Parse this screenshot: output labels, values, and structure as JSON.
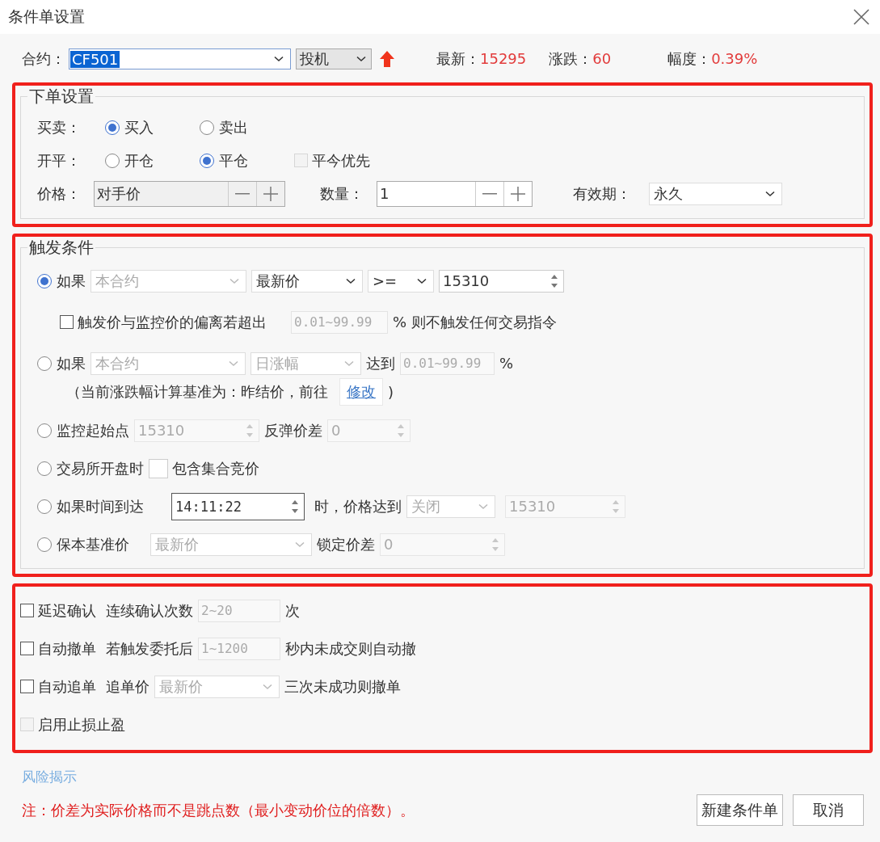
{
  "window": {
    "title": "条件单设置"
  },
  "contract": {
    "label": "合约：",
    "value": "CF501",
    "hedge": "投机",
    "quotes": [
      {
        "label": "最新：",
        "value": "15295"
      },
      {
        "label": "涨跌：",
        "value": "60"
      },
      {
        "label": "幅度：",
        "value": "0.39%"
      }
    ]
  },
  "order_settings": {
    "title": "下单设置",
    "side": {
      "label": "买卖：",
      "options": [
        {
          "label": "买入",
          "selected": true
        },
        {
          "label": "卖出",
          "selected": false
        }
      ]
    },
    "open_close": {
      "label": "开平：",
      "options": [
        {
          "label": "开仓",
          "selected": false
        },
        {
          "label": "平仓",
          "selected": true
        }
      ]
    },
    "close_today_first": {
      "label": "平今优先",
      "checked": false,
      "disabled": true
    },
    "price": {
      "label": "价格：",
      "value": "对手价"
    },
    "quantity": {
      "label": "数量：",
      "value": "1"
    },
    "validity": {
      "label": "有效期：",
      "value": "永久"
    }
  },
  "trigger": {
    "title": "触发条件",
    "conditions": [
      {
        "label": "如果",
        "selected": true,
        "parts": [
          {
            "kind": "select",
            "value": "本合约",
            "disabled": true
          },
          {
            "kind": "select",
            "value": "最新价",
            "disabled": false
          },
          {
            "kind": "select",
            "value": ">=",
            "disabled": false
          },
          {
            "kind": "spin",
            "value": "15310",
            "disabled": false
          }
        ],
        "extra": [
          {
            "kind": "checkbox",
            "label": "触发价与监控价的偏离若超出",
            "checked": false,
            "disabled": false
          },
          {
            "kind": "input",
            "placeholder": "0.01~99.99"
          },
          {
            "kind": "text",
            "text": "%"
          },
          {
            "kind": "text",
            "text": "则不触发任何交易指令"
          }
        ]
      },
      {
        "label": "如果",
        "selected": false,
        "parts": [
          {
            "kind": "select",
            "value": "本合约",
            "disabled": true
          },
          {
            "kind": "select",
            "value": "日涨幅",
            "disabled": true
          },
          {
            "kind": "text",
            "text": "达到"
          },
          {
            "kind": "input",
            "placeholder": "0.01~99.99"
          },
          {
            "kind": "text",
            "text": "%"
          }
        ],
        "extra": [
          {
            "kind": "text",
            "text": "（当前涨跌幅计算基准为：昨结价，前往"
          },
          {
            "kind": "link",
            "text": "修改"
          },
          {
            "kind": "text",
            "text": ")"
          }
        ]
      },
      {
        "label": "监控起始点",
        "selected": false,
        "parts": [
          {
            "kind": "spin",
            "value": "15310",
            "disabled": true
          },
          {
            "kind": "text",
            "text": "反弹价差"
          },
          {
            "kind": "spin",
            "value": "0",
            "disabled": true
          }
        ]
      },
      {
        "label": "交易所开盘时",
        "selected": false,
        "parts": [
          {
            "kind": "checkbox",
            "label": "包含集合竞价",
            "checked": false,
            "disabled": false
          }
        ]
      },
      {
        "label": "如果时间到达",
        "selected": false,
        "parts": [
          {
            "kind": "time",
            "value": "14:11:22",
            "disabled": false
          },
          {
            "kind": "text",
            "text": "时，价格达到"
          },
          {
            "kind": "select",
            "value": "关闭",
            "disabled": true
          },
          {
            "kind": "spin",
            "value": "15310",
            "disabled": true
          }
        ]
      },
      {
        "label": "保本基准价",
        "selected": false,
        "parts": [
          {
            "kind": "select",
            "value": "最新价",
            "disabled": true
          },
          {
            "kind": "text",
            "text": "锁定价差"
          },
          {
            "kind": "spin",
            "value": "0",
            "disabled": true
          }
        ]
      }
    ]
  },
  "options": [
    {
      "label": "延迟确认",
      "checked": false,
      "disabled": false,
      "parts": [
        {
          "kind": "text",
          "text": "连续确认次数"
        },
        {
          "kind": "input",
          "placeholder": "2~20"
        },
        {
          "kind": "text",
          "text": "次"
        }
      ]
    },
    {
      "label": "自动撤单",
      "checked": false,
      "disabled": false,
      "parts": [
        {
          "kind": "text",
          "text": "若触发委托后"
        },
        {
          "kind": "input",
          "placeholder": "1~1200"
        },
        {
          "kind": "text",
          "text": "秒内未成交则自动撤"
        }
      ]
    },
    {
      "label": "自动追单",
      "checked": false,
      "disabled": false,
      "parts": [
        {
          "kind": "text",
          "text": "追单价"
        },
        {
          "kind": "select",
          "value": "最新价",
          "disabled": true
        },
        {
          "kind": "text",
          "text": "三次未成功则撤单"
        }
      ]
    },
    {
      "label": "启用止损止盈",
      "checked": false,
      "disabled": true
    }
  ],
  "risk_link": "风险揭示",
  "note": "注：价差为实际价格而不是跳点数（最小变动价位的倍数）。",
  "buttons": [
    "新建条件单",
    "取消"
  ]
}
